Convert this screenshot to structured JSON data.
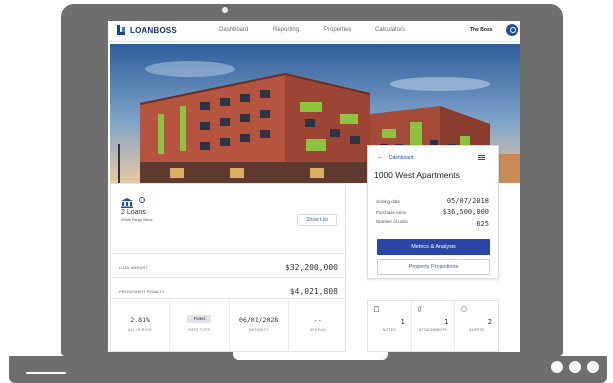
{
  "app": {
    "logo_text": "LOANBOSS",
    "brand_color": "#1f3f8f",
    "accent_color": "#2c45a8"
  },
  "nav": {
    "links": [
      "Dashboard",
      "Reporting",
      "Properties",
      "Calculators"
    ],
    "user_name": "The Boss"
  },
  "loan_card": {
    "loans_count": "2 Loans",
    "bank_name": "Wells Fargo Bank",
    "show_list_label": "Show List",
    "rows": [
      {
        "label": "LOAN AMOUNT",
        "value": "$32,200,000"
      },
      {
        "label": "PREPAYMENT PENALTY",
        "value": "$4,021,808"
      }
    ],
    "metrics": [
      {
        "value": "2.81%",
        "label": "ALL IN RATE"
      },
      {
        "value": "Fixed",
        "label": "RATE TYPE"
      },
      {
        "value": "06/01/2028",
        "label": "MATURITY"
      },
      {
        "value": "--",
        "label": "SPREAD"
      }
    ]
  },
  "property_card": {
    "back_label": "Dashboard",
    "title": "1000 West Apartments",
    "closing_date_label": "closing date",
    "closing_date": "05/07/2018",
    "purchase_price_label": "Purchase price",
    "purchase_price": "$36,500,000",
    "units_label": "Number of units",
    "units": "625",
    "primary_button": "Metrics & Analysis",
    "secondary_button": "Property Projections"
  },
  "stats": [
    {
      "icon": "document-icon",
      "value": "1",
      "label": "NOTES"
    },
    {
      "icon": "attachment-icon",
      "value": "1",
      "label": "ATTACHMENTS"
    },
    {
      "icon": "clock-icon",
      "value": "2",
      "label": "ALERTS"
    }
  ]
}
